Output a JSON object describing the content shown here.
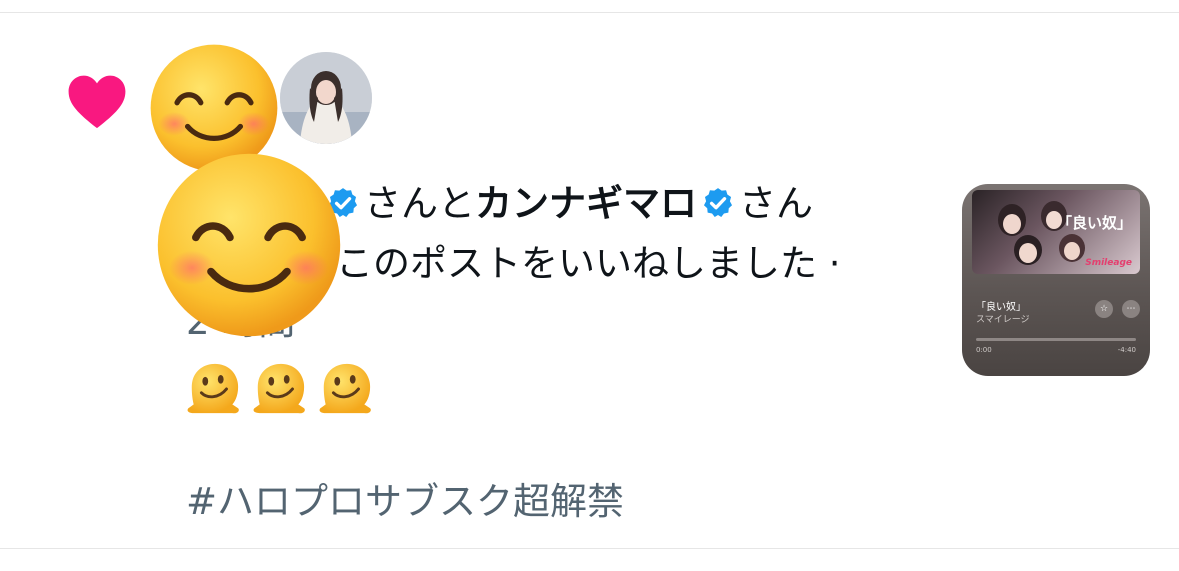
{
  "notification": {
    "text_part1": "さんと",
    "user2": "カンナギマロ",
    "text_part2": "さん",
    "line2": "このポストをいいねしました ·",
    "time_partial": "2 時間",
    "emojis_line": [
      "🫠",
      "🫠",
      "🫠"
    ],
    "hashtag": "#ハロプロサブスク超解禁"
  },
  "music_card": {
    "song": "「良い奴」",
    "artist": "スマイレージ",
    "art_title": "「良い奴」",
    "art_brand": "Smileage",
    "time_elapsed": "0:00",
    "time_remaining": "-4:40"
  },
  "colors": {
    "heart": "#f91880",
    "verified": "#1d9bf0",
    "text": "#0f1419",
    "secondary_text": "#536471"
  },
  "icons": [
    "heart-icon",
    "verified-badge-icon",
    "smiling-face-emoji",
    "melting-face-emoji",
    "star-icon",
    "more-icon"
  ]
}
